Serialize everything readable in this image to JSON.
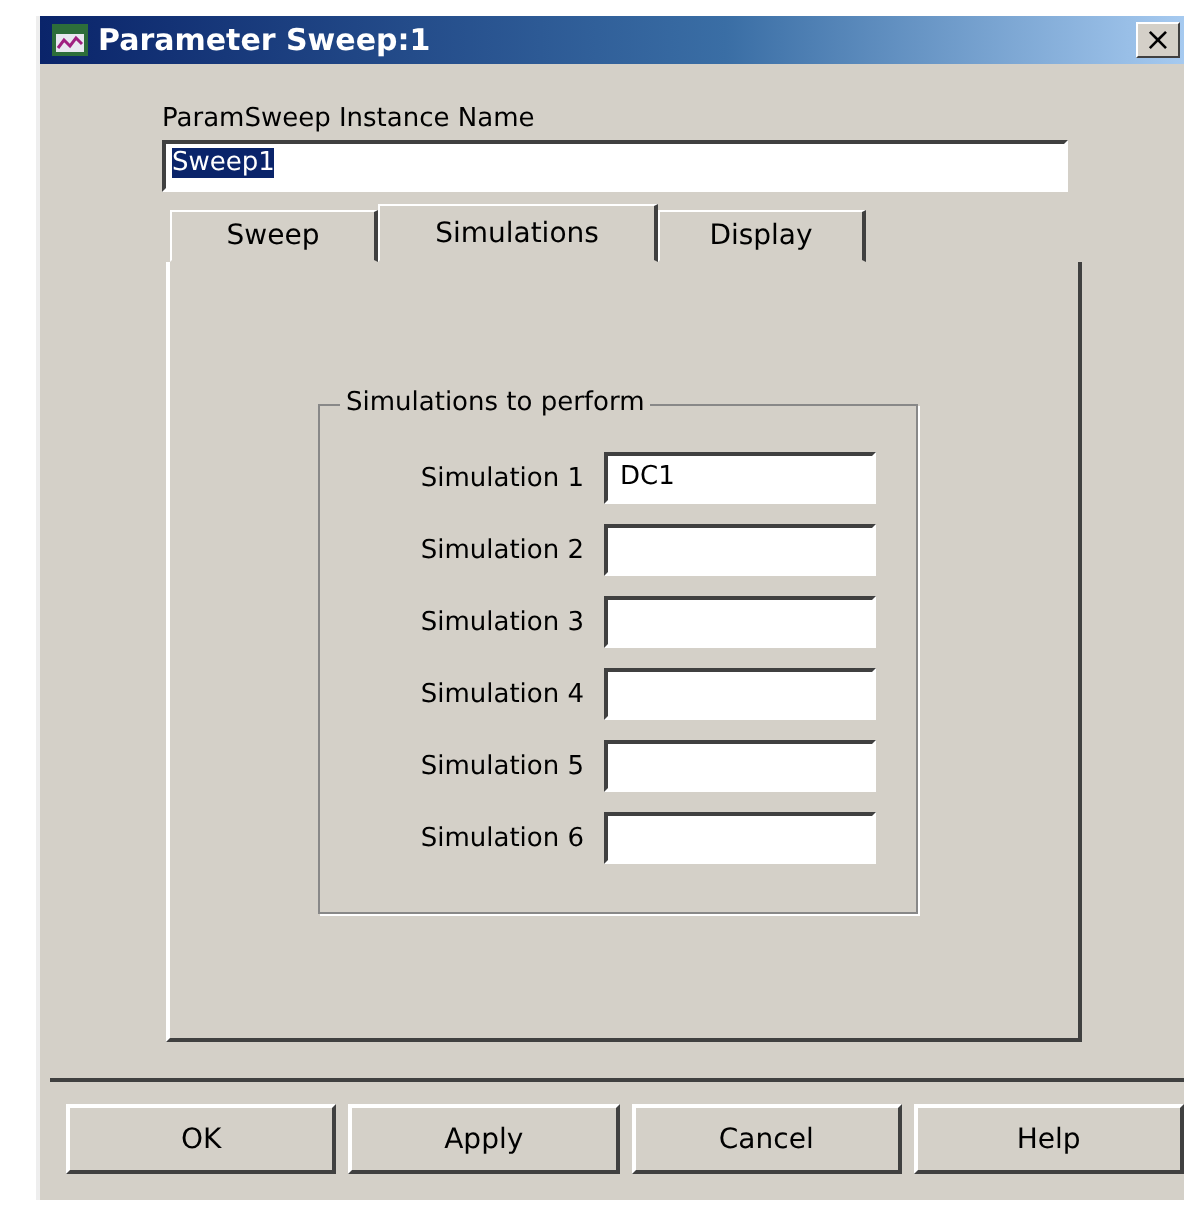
{
  "window": {
    "title": "Parameter Sweep:1",
    "close": "×"
  },
  "instance_name": {
    "label": "ParamSweep Instance Name",
    "value": "Sweep1",
    "text_selected": true
  },
  "tabs": [
    {
      "label": "Sweep",
      "selected": false
    },
    {
      "label": "Simulations",
      "selected": true
    },
    {
      "label": "Display",
      "selected": false
    }
  ],
  "group": {
    "title": "Simulations to perform",
    "rows": [
      {
        "label": "Simulation 1",
        "value": "DC1"
      },
      {
        "label": "Simulation 2"
      },
      {
        "label": "Simulation 3"
      },
      {
        "label": "Simulation 4"
      },
      {
        "label": "Simulation 5"
      },
      {
        "label": "Simulation 6"
      }
    ]
  },
  "buttons": [
    "OK",
    "Apply",
    "Cancel",
    "Help"
  ]
}
